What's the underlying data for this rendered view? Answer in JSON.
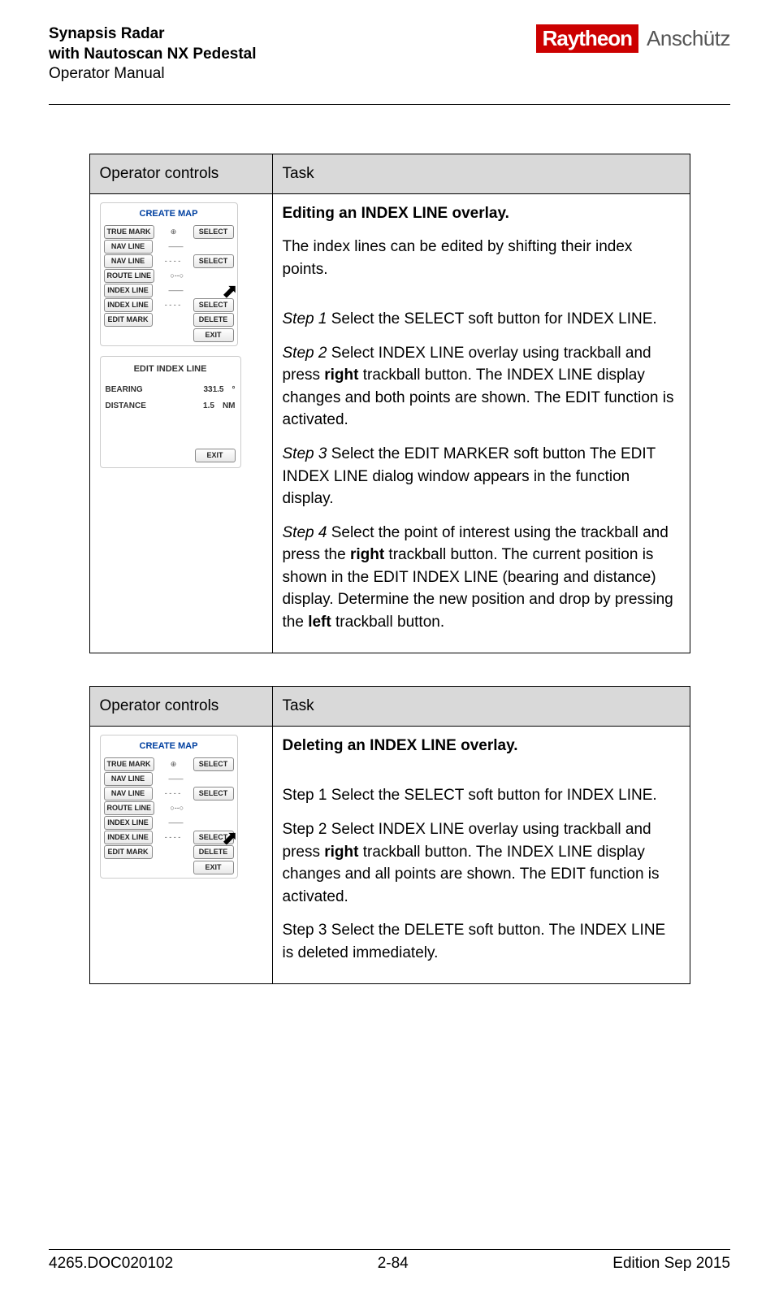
{
  "header": {
    "line1": "Synapsis Radar",
    "line2": "with Nautoscan NX Pedestal",
    "line3": "Operator Manual",
    "logo_brand": "Raytheon",
    "logo_sub": "Anschütz"
  },
  "table1": {
    "col1": "Operator controls",
    "col2": "Task",
    "task_title": "Editing an INDEX LINE overlay.",
    "intro": "The index lines can be edited by shifting their index points.",
    "step1_label": "Step 1",
    "step1_text": " Select the SELECT soft button for INDEX LINE.",
    "step2_label": "Step 2",
    "step2_pre": " Select INDEX LINE overlay using trackball and press ",
    "step2_bold": "right",
    "step2_post": " trackball button. The INDEX LINE display changes and both points are shown. The EDIT function is activated.",
    "step3_label": "Step 3",
    "step3_text": " Select the EDIT MARKER soft button The EDIT INDEX LINE dialog window appears in the function display.",
    "step4_label": "Step 4",
    "step4_pre": " Select the point of interest using the trackball and press the ",
    "step4_bold1": "right",
    "step4_mid": " trackball button. The current position is shown in the EDIT INDEX LINE (bearing and distance) display. Determine the new position and drop by pressing the ",
    "step4_bold2": "left",
    "step4_post": " trackball button."
  },
  "panel_create": {
    "title": "CREATE MAP",
    "rows": [
      {
        "left": "TRUE MARK",
        "mid": "⊕",
        "right": "SELECT"
      },
      {
        "left": "NAV LINE",
        "mid": "——",
        "right": ""
      },
      {
        "left": "NAV LINE",
        "mid": "- - - -",
        "right": "SELECT"
      },
      {
        "left": "ROUTE LINE",
        "mid": "○--○",
        "right": ""
      },
      {
        "left": "INDEX LINE",
        "mid": "——",
        "right": ""
      },
      {
        "left": "INDEX LINE",
        "mid": "- - - -",
        "right": "SELECT"
      },
      {
        "left": "EDIT MARK",
        "mid": "",
        "right": "DELETE"
      }
    ],
    "exit": "EXIT"
  },
  "panel_edit": {
    "title": "EDIT INDEX LINE",
    "bearing_label": "BEARING",
    "bearing_val": "331.5",
    "bearing_unit": "°",
    "distance_label": "DISTANCE",
    "distance_val": "1.5",
    "distance_unit": "NM",
    "exit": "EXIT"
  },
  "table2": {
    "col1": "Operator controls",
    "col2": "Task",
    "task_title": "Deleting an INDEX LINE overlay.",
    "step1": "Step 1 Select the SELECT soft button for INDEX LINE.",
    "step2_pre": "Step 2 Select INDEX LINE overlay using trackball and press ",
    "step2_bold": "right",
    "step2_post": " trackball button. The INDEX LINE display changes and all points are shown. The EDIT function is activated.",
    "step3": "Step 3 Select the DELETE soft button. The INDEX LINE is deleted immediately."
  },
  "footer": {
    "left": "4265.DOC020102",
    "center": "2-84",
    "right": "Edition Sep 2015"
  }
}
